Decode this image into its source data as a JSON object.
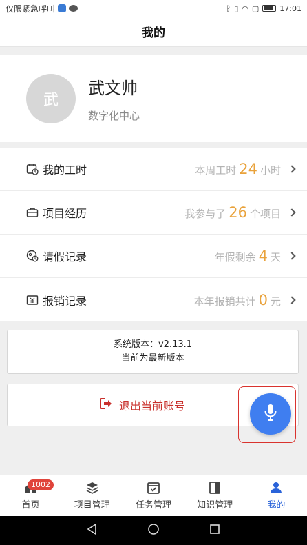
{
  "status_bar": {
    "left_text": "仅限紧急呼叫",
    "time": "17:01"
  },
  "header": {
    "title": "我的"
  },
  "profile": {
    "avatar_text": "武",
    "name": "武文帅",
    "department": "数字化中心"
  },
  "menu": [
    {
      "label": "我的工时",
      "icon": "calendar-clock-icon",
      "prefix": "本周工时",
      "value": "24",
      "suffix": "小时"
    },
    {
      "label": "项目经历",
      "icon": "briefcase-icon",
      "prefix": "我参与了",
      "value": "26",
      "suffix": "个项目"
    },
    {
      "label": "请假记录",
      "icon": "leave-icon",
      "prefix": "年假剩余",
      "value": "4",
      "suffix": "天"
    },
    {
      "label": "报销记录",
      "icon": "receipt-icon",
      "prefix": "本年报销共计",
      "value": "0",
      "suffix": "元"
    }
  ],
  "version": {
    "line1": "系统版本：v2.13.1",
    "line2": "当前为最新版本"
  },
  "logout": {
    "label": "退出当前账号"
  },
  "tabs": [
    {
      "label": "首页",
      "icon": "home-icon",
      "badge": "1002"
    },
    {
      "label": "项目管理",
      "icon": "layers-icon"
    },
    {
      "label": "任务管理",
      "icon": "task-calendar-icon"
    },
    {
      "label": "知识管理",
      "icon": "book-icon"
    },
    {
      "label": "我的",
      "icon": "user-icon",
      "active": true
    }
  ],
  "colors": {
    "accent_number": "#e9a23b",
    "logout_red": "#c9302c",
    "active_tab_blue": "#2a63d9",
    "voice_button_blue": "#3f7ef0",
    "badge_red": "#e0443b"
  }
}
